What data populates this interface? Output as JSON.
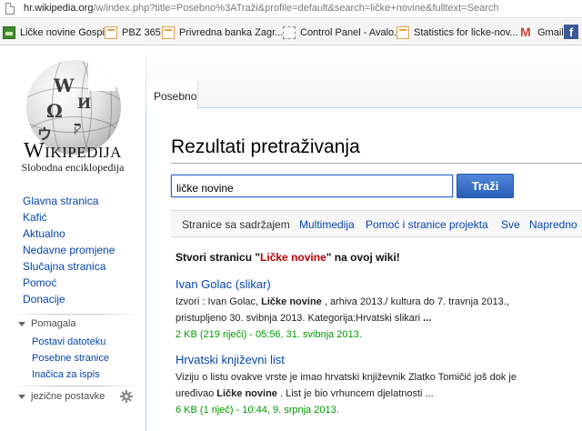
{
  "browser": {
    "url_host": "hr.wikipedia.org",
    "url_rest": "/w/index.php?title=Posebno%3ATraži&profile=default&search=ličke+novine&fulltext=Search",
    "bookmarks": [
      {
        "label": "Ličke novine Gospić",
        "icon": "lika-favicon"
      },
      {
        "label": "PBZ 365",
        "icon": "ht-favicon"
      },
      {
        "label": "Privredna banka Zagr...",
        "icon": "ht-favicon"
      },
      {
        "label": "Control Panel - Avalo...",
        "icon": "page-icon"
      },
      {
        "label": "Statistics for licke-nov...",
        "icon": "ht-favicon"
      },
      {
        "label": "Gmail",
        "icon": "gmail-icon"
      },
      {
        "label": "f",
        "icon": "facebook-icon"
      }
    ]
  },
  "logo": {
    "wordmark": "Wikipedija",
    "tagline": "Slobodna enciklopedija"
  },
  "sidebar": {
    "main_links": [
      "Glavna stranica",
      "Kafić",
      "Aktualno",
      "Nedavne promjene",
      "Slučajna stranica",
      "Pomoć",
      "Donacije"
    ],
    "tools_heading": "Pomagala",
    "tools_links": [
      "Postavi datoteku",
      "Posebne stranice",
      "Inačica za ispis"
    ],
    "language_heading": "jezične postavke"
  },
  "tabs": {
    "special": "Posebno"
  },
  "page": {
    "title": "Rezultati pretraživanja",
    "search_value": "ličke novine",
    "search_button": "Traži",
    "filters": [
      "Stranice sa sadržajem",
      "Multimedija",
      "Pomoć i stranice projekta",
      "Sve",
      "Napredno"
    ],
    "create_prefix": "Stvori stranicu \"",
    "create_term": "Ličke novine",
    "create_suffix": "\" na ovoj wiki!"
  },
  "results": [
    {
      "title": "Ivan Golac (slikar)",
      "line1_a": "Izvori : Ivan Golac, ",
      "line1_bold": "Ličke novine",
      "line1_b": " , arhiva 2013./ kultura do 7. travnja 2013.,",
      "line2_a": "pristupljeno 30. svibnja 2013. Kategorija:Hrvatski slikari ",
      "line2_bold": "...",
      "line2_b": "",
      "meta": "2 KB (219 riječi) - 05:56, 31. svibnja 2013."
    },
    {
      "title": "Hrvatski književni list",
      "line1_a": "Viziju o listu ovakve vrste je imao hrvatski književnik Zlatko Tomičić još dok je",
      "line1_bold": "",
      "line1_b": "",
      "line2_a": "uređivao ",
      "line2_bold": "Ličke novine",
      "line2_b": " . List je bio vrhuncem djelatnosti ...",
      "meta": "6 KB (1 riječ) - 10:44, 9. srpnja 2013."
    }
  ],
  "colors": {
    "link": "#0645ad",
    "redlink": "#ba0000",
    "meta_green": "#009a00",
    "button_blue": "#3a6fc8"
  }
}
